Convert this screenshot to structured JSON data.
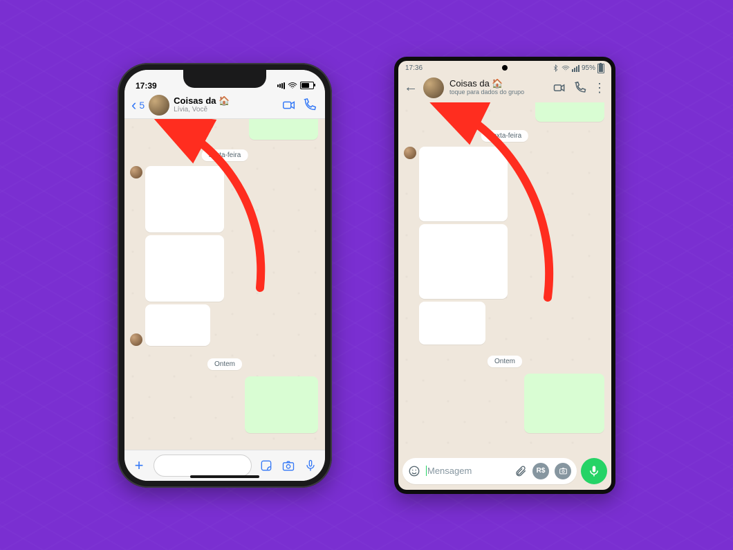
{
  "ios": {
    "status": {
      "time": "17:39"
    },
    "header": {
      "back_count": "5",
      "title": "Coisas da 🏠",
      "subtitle": "Lívia, Você"
    },
    "dates": {
      "friday": "sexta-feira",
      "yesterday": "Ontem"
    }
  },
  "android": {
    "status": {
      "time": "17:36",
      "battery": "95%"
    },
    "header": {
      "title": "Coisas da 🏠",
      "subtitle": "toque para dados do grupo"
    },
    "dates": {
      "friday": "Sexta-feira",
      "yesterday": "Ontem"
    },
    "input": {
      "placeholder": "Mensagem",
      "currency": "R$"
    }
  }
}
